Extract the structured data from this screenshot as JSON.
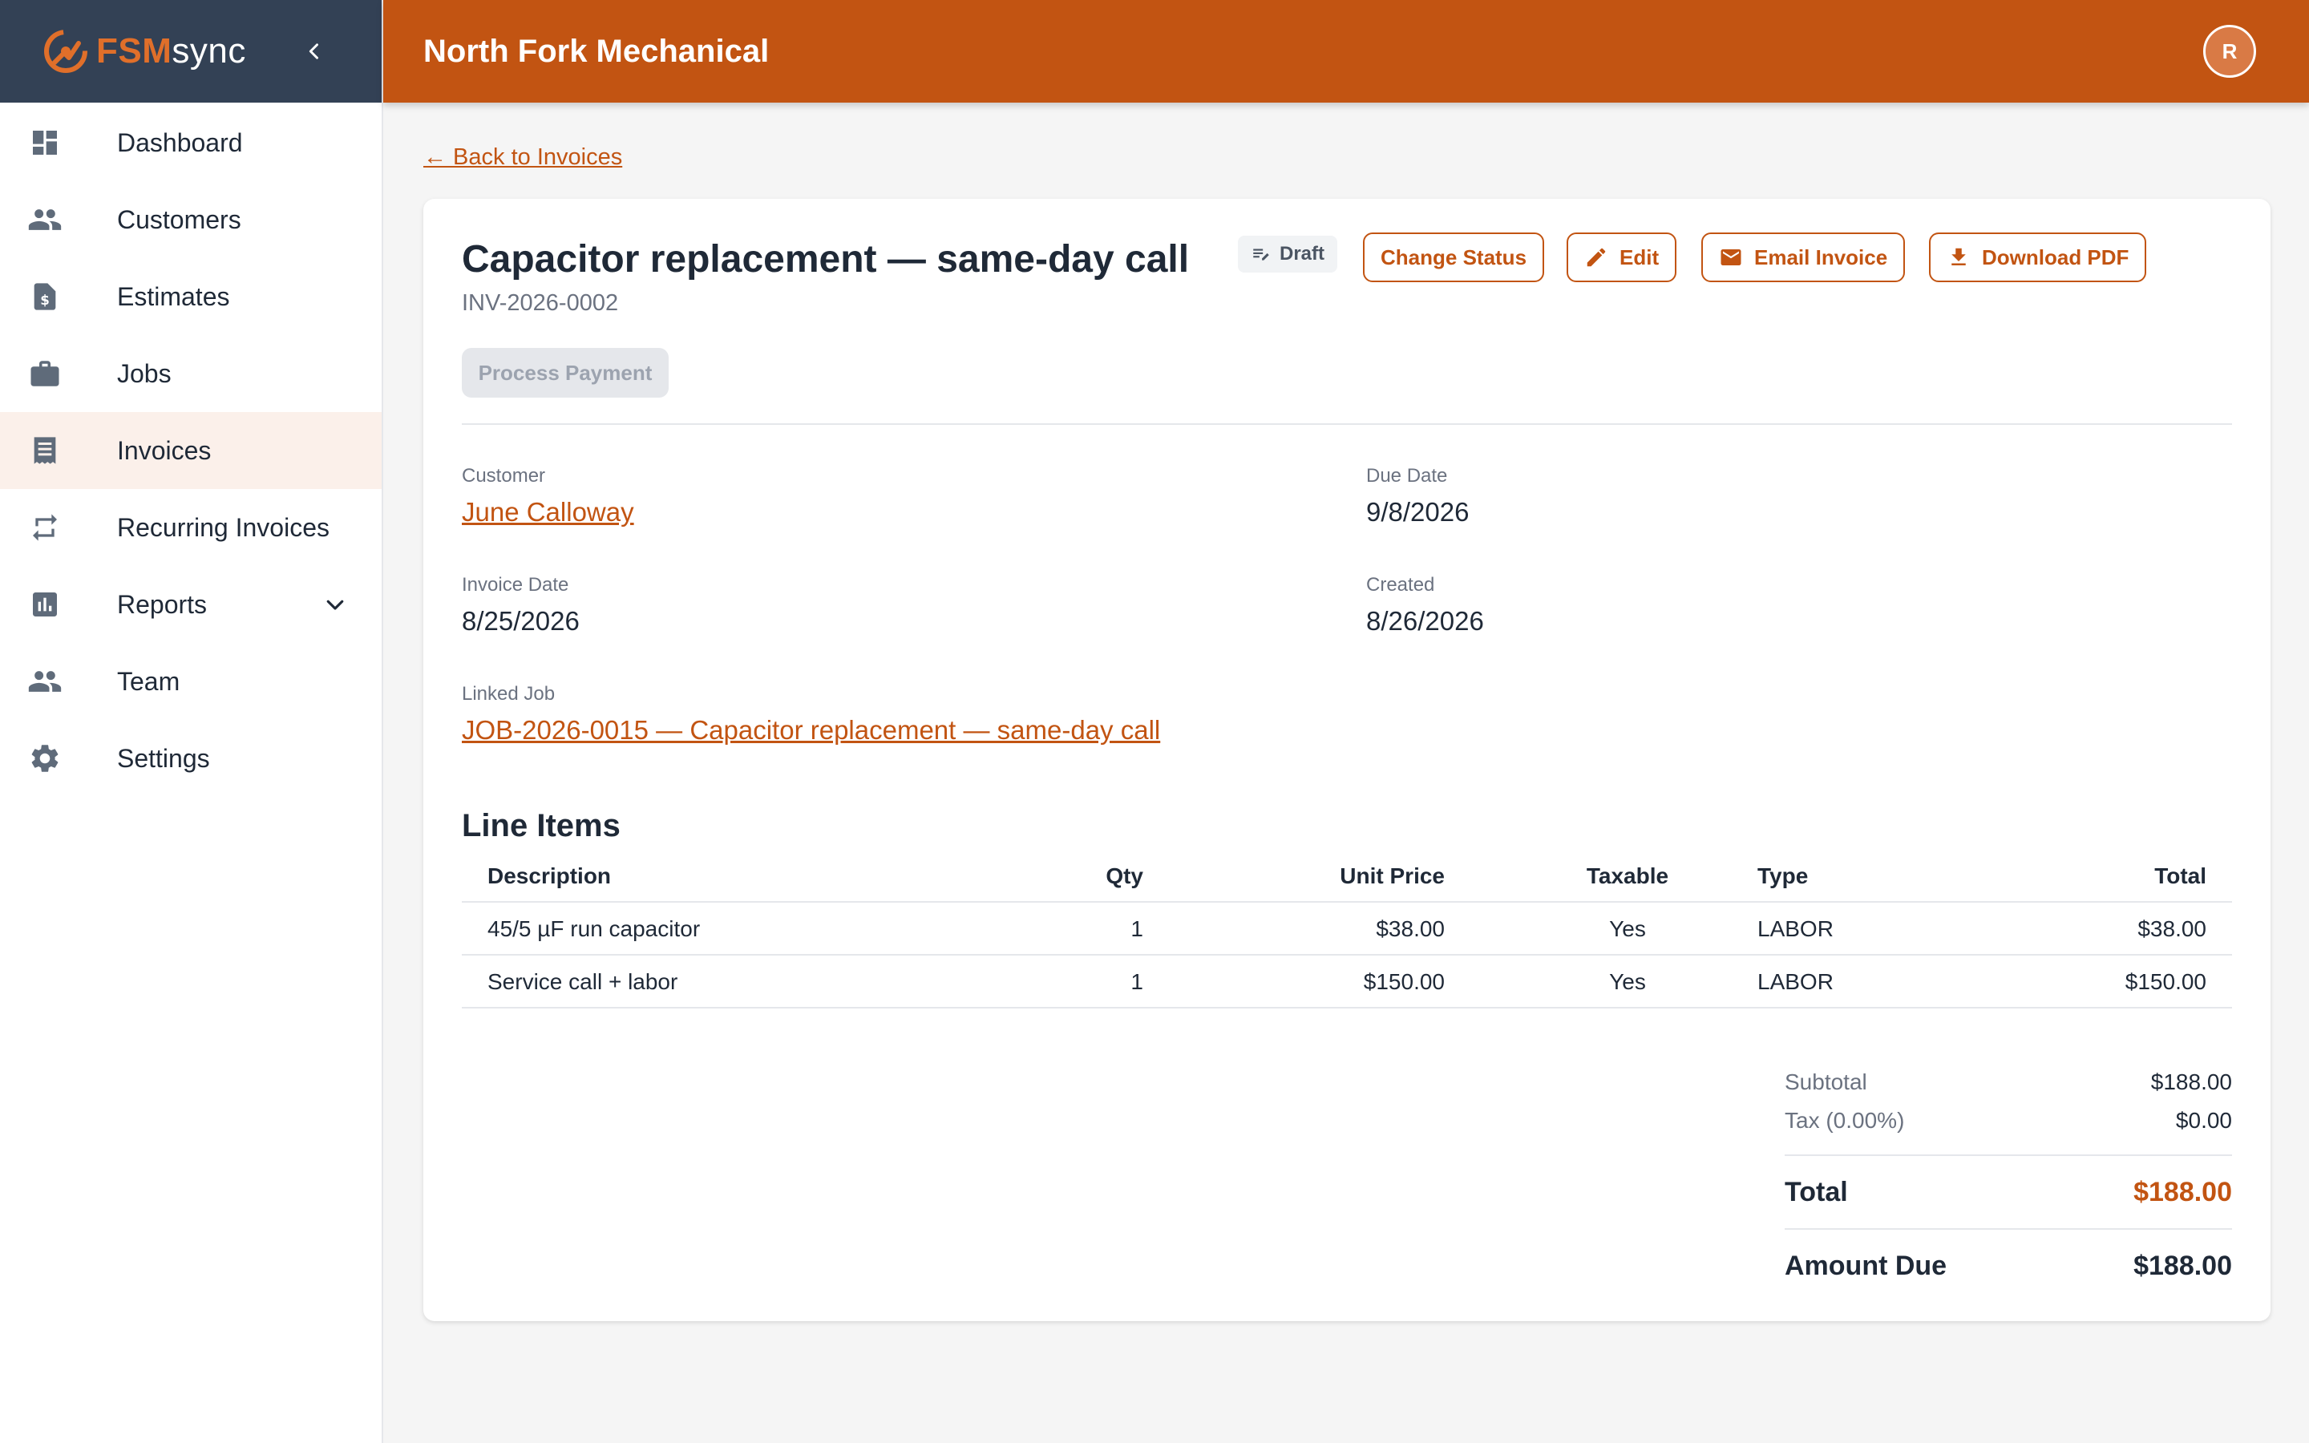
{
  "app": {
    "brand_fsm": "FSM",
    "brand_sync": "sync",
    "company": "North Fork Mechanical",
    "avatar_initial": "R",
    "accent_color": "#c25412"
  },
  "sidebar": {
    "items": [
      {
        "label": "Dashboard",
        "icon": "dashboard-icon"
      },
      {
        "label": "Customers",
        "icon": "people-icon"
      },
      {
        "label": "Estimates",
        "icon": "estimate-document-icon"
      },
      {
        "label": "Jobs",
        "icon": "briefcase-icon"
      },
      {
        "label": "Invoices",
        "icon": "receipt-icon",
        "active": true
      },
      {
        "label": "Recurring Invoices",
        "icon": "repeat-icon"
      },
      {
        "label": "Reports",
        "icon": "bar-chart-icon",
        "expandable": true
      },
      {
        "label": "Team",
        "icon": "team-icon"
      },
      {
        "label": "Settings",
        "icon": "gear-icon"
      }
    ]
  },
  "page": {
    "back_link": "← Back to Invoices",
    "title": "Capacitor replacement — same-day call",
    "status": "Draft",
    "invoice_number": "INV-2026-0002",
    "actions": {
      "change_status": "Change Status",
      "edit": "Edit",
      "email": "Email Invoice",
      "download": "Download PDF",
      "process_payment": "Process Payment"
    },
    "fields": {
      "customer_label": "Customer",
      "customer": "June Calloway",
      "due_date_label": "Due Date",
      "due_date": "9/8/2026",
      "invoice_date_label": "Invoice Date",
      "invoice_date": "8/25/2026",
      "created_label": "Created",
      "created": "8/26/2026",
      "linked_job_label": "Linked Job",
      "linked_job": "JOB-2026-0015 — Capacitor replacement — same-day call"
    },
    "line_items": {
      "title": "Line Items",
      "columns": {
        "description": "Description",
        "qty": "Qty",
        "unit_price": "Unit Price",
        "taxable": "Taxable",
        "type": "Type",
        "total": "Total"
      },
      "rows": [
        {
          "description": "45/5 µF run capacitor",
          "qty": "1",
          "unit_price": "$38.00",
          "taxable": "Yes",
          "type": "LABOR",
          "total": "$38.00"
        },
        {
          "description": "Service call + labor",
          "qty": "1",
          "unit_price": "$150.00",
          "taxable": "Yes",
          "type": "LABOR",
          "total": "$150.00"
        }
      ]
    },
    "totals": {
      "subtotal_label": "Subtotal",
      "subtotal": "$188.00",
      "tax_label": "Tax (0.00%)",
      "tax": "$0.00",
      "total_label": "Total",
      "total": "$188.00",
      "amount_due_label": "Amount Due",
      "amount_due": "$188.00"
    }
  }
}
